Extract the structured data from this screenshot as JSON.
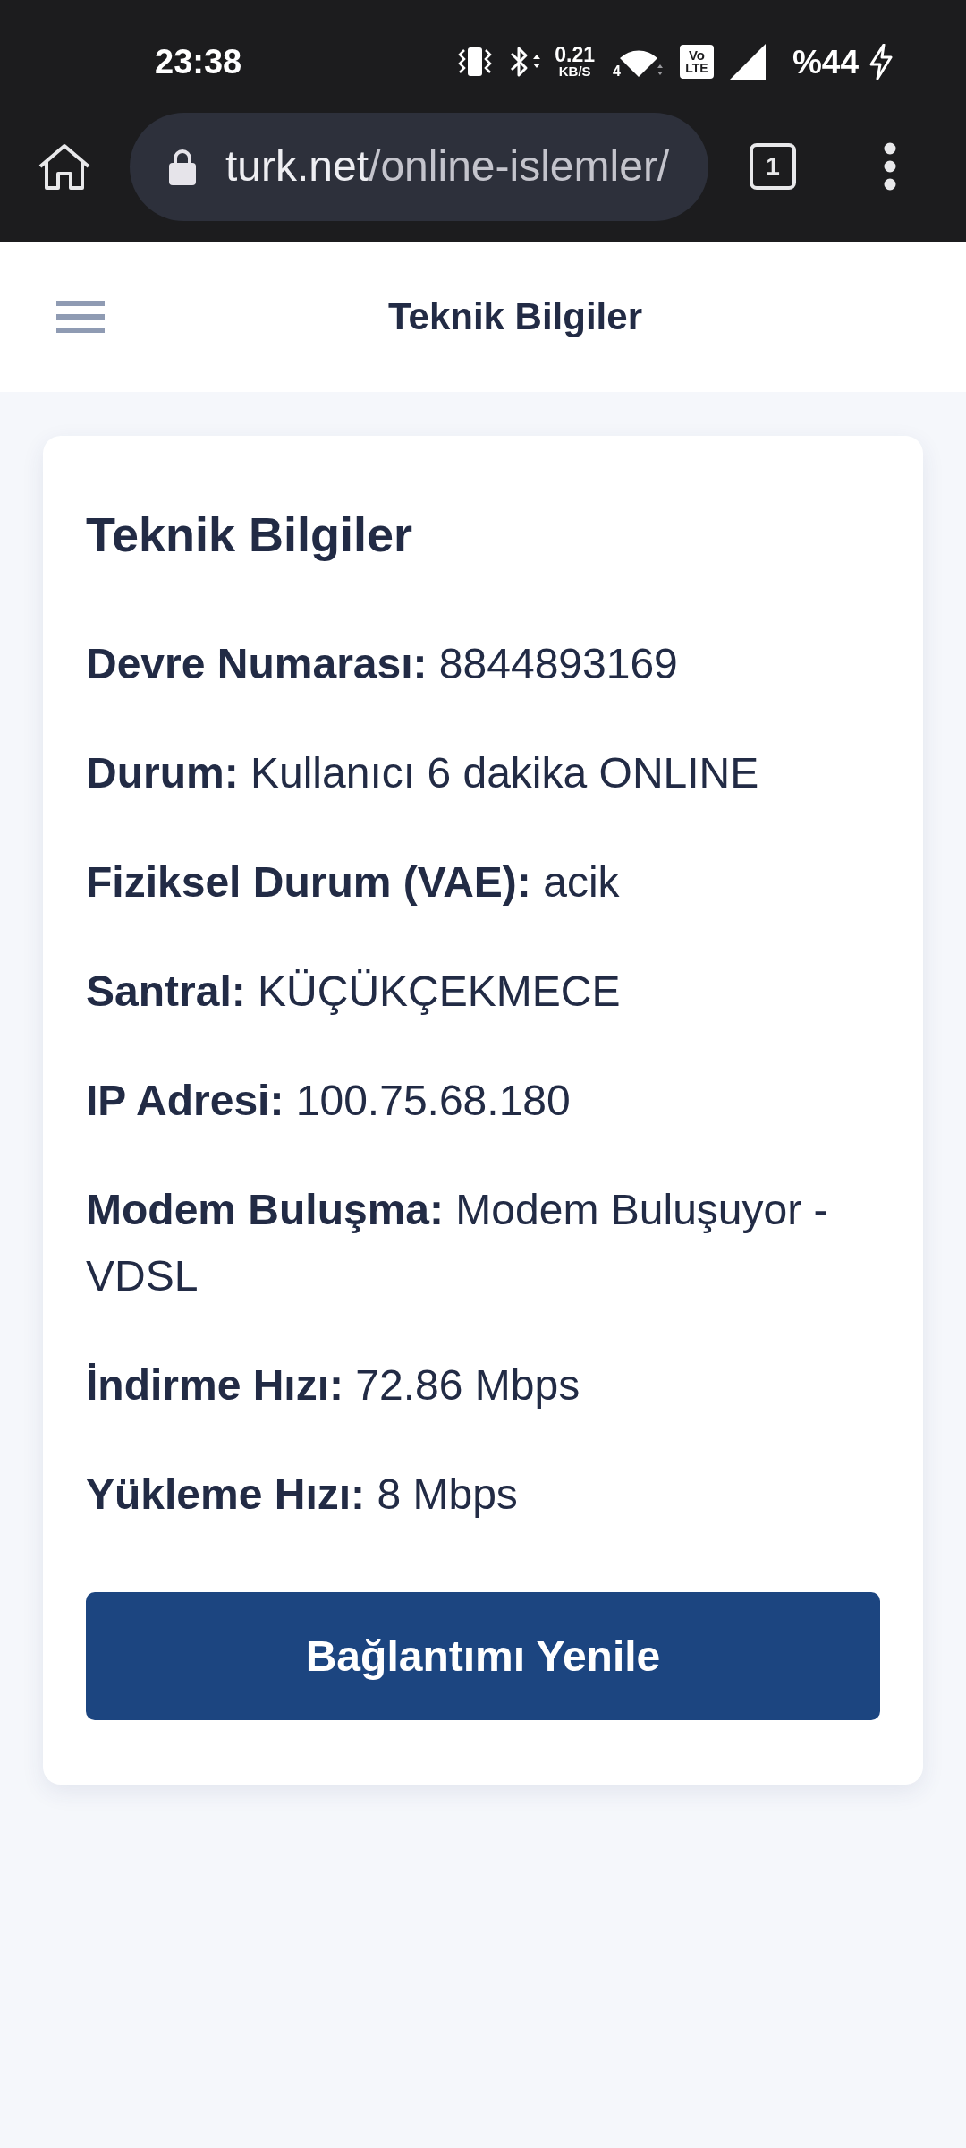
{
  "status_bar": {
    "time": "23:38",
    "data_speed": "0.21",
    "data_speed_unit": "KB/S",
    "wifi_label": "4",
    "volte_top": "Vo",
    "volte_bottom": "LTE",
    "battery": "%44",
    "charging": true
  },
  "browser": {
    "secure": true,
    "url_domain": "turk.net",
    "url_path": "/online-islemler/",
    "tab_count": "1"
  },
  "header": {
    "title": "Teknik Bilgiler"
  },
  "card": {
    "title": "Teknik Bilgiler",
    "fields": [
      {
        "label": "Devre Numarası:",
        "value": "8844893169"
      },
      {
        "label": "Durum:",
        "value": "Kullanıcı 6 dakika ONLINE"
      },
      {
        "label": "Fiziksel Durum (VAE):",
        "value": "acik"
      },
      {
        "label": "Santral:",
        "value": "KÜÇÜKÇEKMECE"
      },
      {
        "label": "IP Adresi:",
        "value": "100.75.68.180"
      },
      {
        "label": "Modem Buluşma:",
        "value": "Modem Buluşuyor - VDSL"
      },
      {
        "label": "İndirme Hızı:",
        "value": "72.86 Mbps"
      },
      {
        "label": "Yükleme Hızı:",
        "value": "8 Mbps"
      }
    ],
    "button": "Bağlantımı Yenile"
  }
}
